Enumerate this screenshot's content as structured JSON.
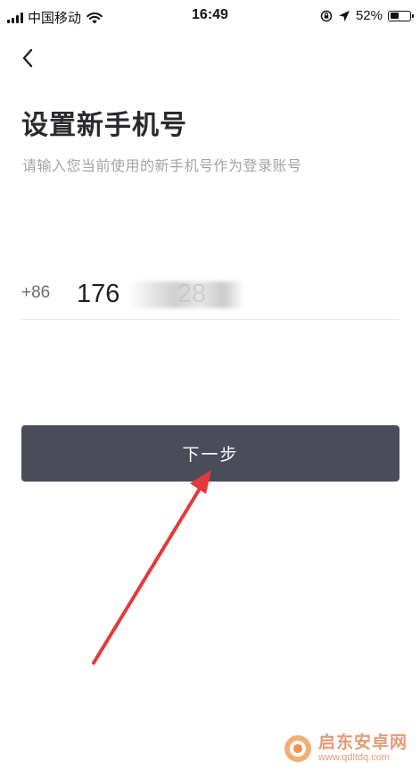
{
  "status_bar": {
    "carrier": "中国移动",
    "time": "16:49",
    "battery_percent": "52%",
    "battery_level": 0.52
  },
  "page": {
    "title": "设置新手机号",
    "subtitle": "请输入您当前使用的新手机号作为登录账号"
  },
  "phone": {
    "country_code": "+86",
    "value": "176        28"
  },
  "next_button": {
    "label": "下一步"
  },
  "annotation": {
    "arrow_color": "#e23a3a"
  },
  "watermark": {
    "name": "启东安卓网",
    "url": "www.qdltdq.com"
  }
}
